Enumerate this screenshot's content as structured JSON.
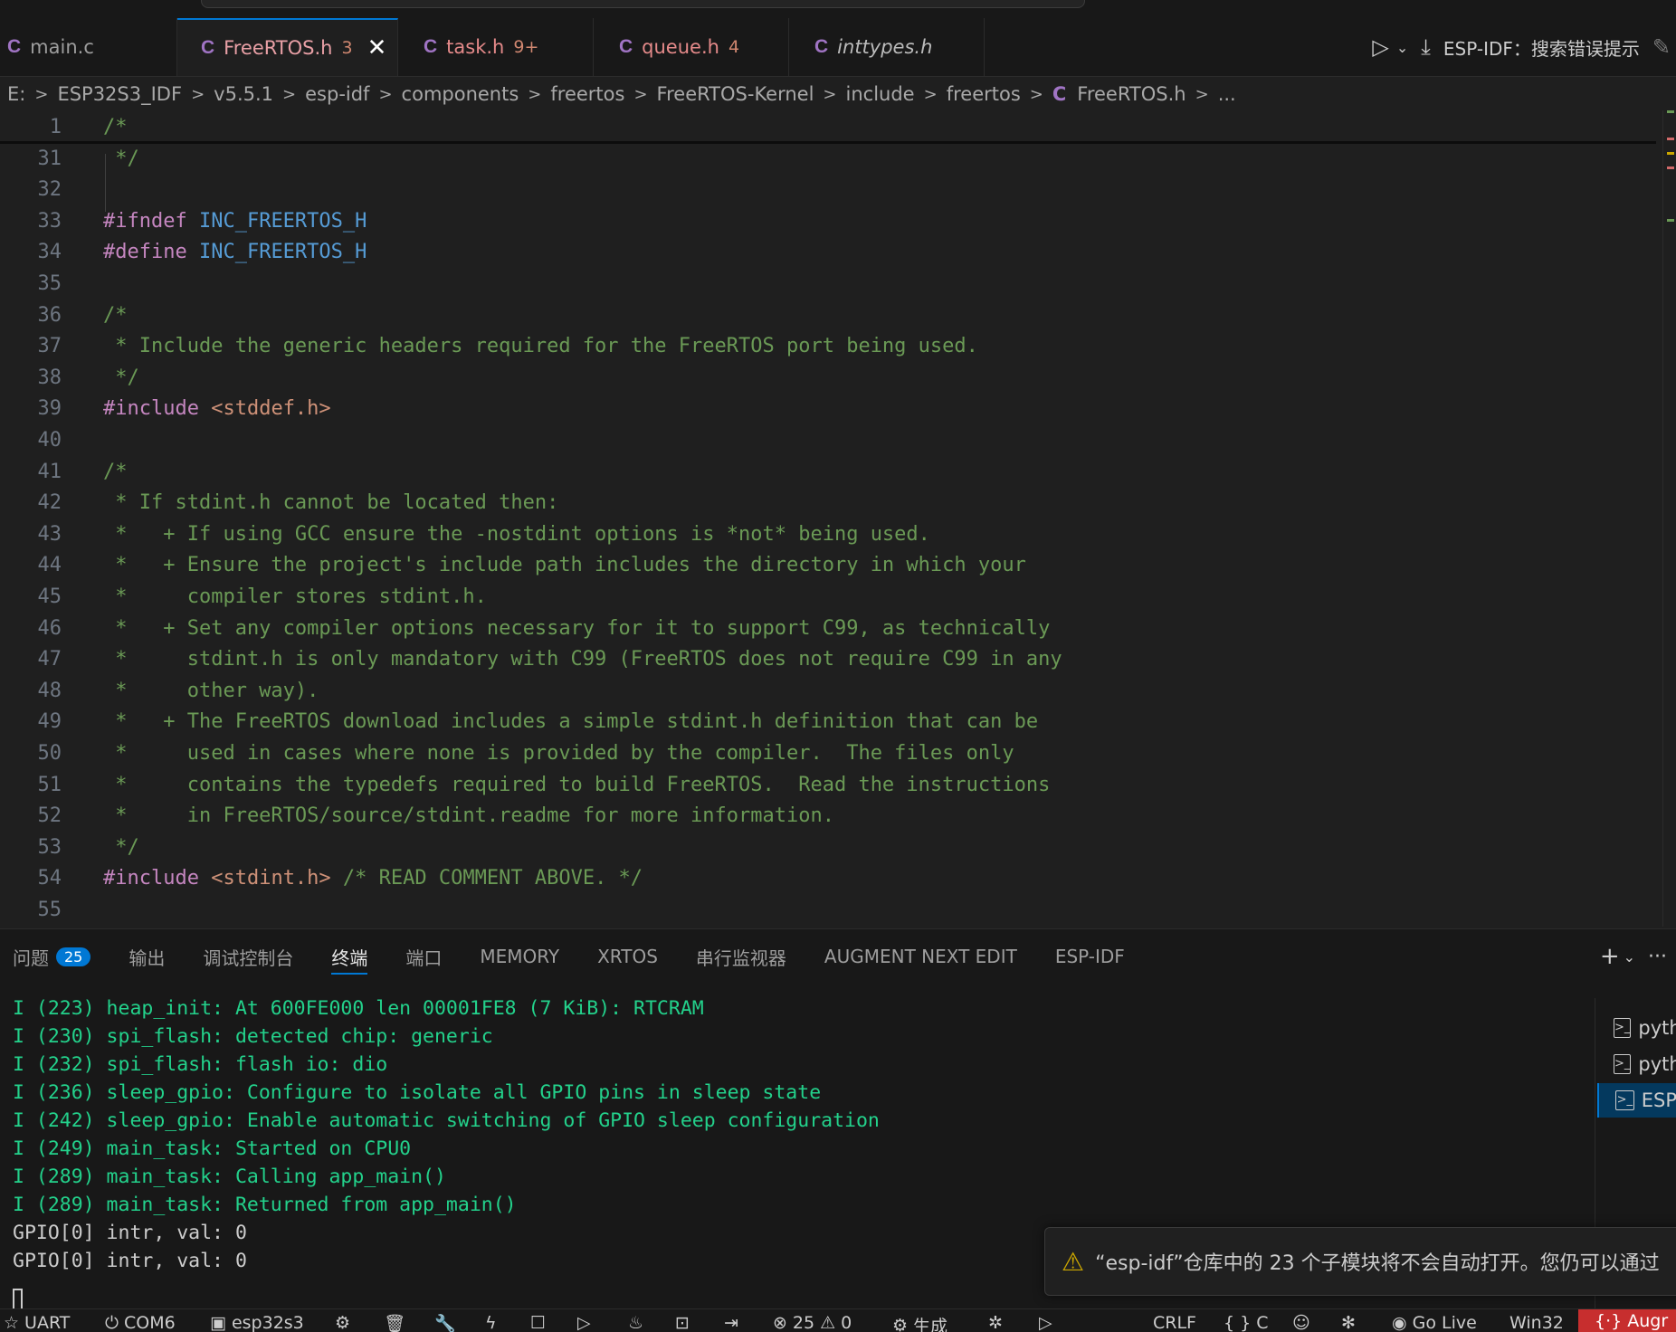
{
  "tabs": [
    {
      "name": "main.c",
      "badge": "",
      "state": "normal"
    },
    {
      "name": "FreeRTOS.h",
      "badge": "3",
      "state": "active"
    },
    {
      "name": "task.h",
      "badge": "9+",
      "state": "mod"
    },
    {
      "name": "queue.h",
      "badge": "4",
      "state": "mod"
    },
    {
      "name": "inttypes.h",
      "badge": "",
      "state": "italic"
    }
  ],
  "tab_icon_letter": "C",
  "tab_actions": {
    "esp_idf_label": "ESP-IDF：搜索错误提示"
  },
  "breadcrumb": [
    "E:",
    "ESP32S3_IDF",
    "v5.5.1",
    "esp-idf",
    "components",
    "freertos",
    "FreeRTOS-Kernel",
    "include",
    "freertos",
    "FreeRTOS.h",
    "..."
  ],
  "editor": {
    "lines": [
      {
        "n": "1",
        "text": "/*"
      },
      {
        "n": "31",
        "text": " */"
      },
      {
        "n": "32",
        "text": ""
      },
      {
        "n": "33",
        "text": "#ifndef INC_FREERTOS_H"
      },
      {
        "n": "34",
        "text": "#define INC_FREERTOS_H"
      },
      {
        "n": "35",
        "text": ""
      },
      {
        "n": "36",
        "text": "/*"
      },
      {
        "n": "37",
        "text": " * Include the generic headers required for the FreeRTOS port being used."
      },
      {
        "n": "38",
        "text": " */"
      },
      {
        "n": "39",
        "text": "#include <stddef.h>"
      },
      {
        "n": "40",
        "text": ""
      },
      {
        "n": "41",
        "text": "/*"
      },
      {
        "n": "42",
        "text": " * If stdint.h cannot be located then:"
      },
      {
        "n": "43",
        "text": " *   + If using GCC ensure the -nostdint options is *not* being used."
      },
      {
        "n": "44",
        "text": " *   + Ensure the project's include path includes the directory in which your"
      },
      {
        "n": "45",
        "text": " *     compiler stores stdint.h."
      },
      {
        "n": "46",
        "text": " *   + Set any compiler options necessary for it to support C99, as technically"
      },
      {
        "n": "47",
        "text": " *     stdint.h is only mandatory with C99 (FreeRTOS does not require C99 in any"
      },
      {
        "n": "48",
        "text": " *     other way)."
      },
      {
        "n": "49",
        "text": " *   + The FreeRTOS download includes a simple stdint.h definition that can be"
      },
      {
        "n": "50",
        "text": " *     used in cases where none is provided by the compiler.  The files only"
      },
      {
        "n": "51",
        "text": " *     contains the typedefs required to build FreeRTOS.  Read the instructions"
      },
      {
        "n": "52",
        "text": " *     in FreeRTOS/source/stdint.readme for more information."
      },
      {
        "n": "53",
        "text": " */"
      },
      {
        "n": "54",
        "text": "#include <stdint.h> /* READ COMMENT ABOVE. */"
      },
      {
        "n": "55",
        "text": ""
      }
    ]
  },
  "panel": {
    "tabs": [
      {
        "label": "问题",
        "count": "25"
      },
      {
        "label": "输出",
        "count": ""
      },
      {
        "label": "调试控制台",
        "count": ""
      },
      {
        "label": "终端",
        "count": ""
      },
      {
        "label": "端口",
        "count": ""
      },
      {
        "label": "MEMORY",
        "count": ""
      },
      {
        "label": "XRTOS",
        "count": ""
      },
      {
        "label": "串行监视器",
        "count": ""
      },
      {
        "label": "AUGMENT NEXT EDIT",
        "count": ""
      },
      {
        "label": "ESP-IDF",
        "count": ""
      }
    ],
    "active_tab": "终端",
    "terminal_lines": [
      {
        "text": "I (223) heap_init: At 600FE000 len 00001FE8 (7 KiB): RTCRAM",
        "kind": "info"
      },
      {
        "text": "I (230) spi_flash: detected chip: generic",
        "kind": "info"
      },
      {
        "text": "I (232) spi_flash: flash io: dio",
        "kind": "info"
      },
      {
        "text": "I (236) sleep_gpio: Configure to isolate all GPIO pins in sleep state",
        "kind": "info"
      },
      {
        "text": "I (242) sleep_gpio: Enable automatic switching of GPIO sleep configuration",
        "kind": "info"
      },
      {
        "text": "I (249) main_task: Started on CPU0",
        "kind": "info"
      },
      {
        "text": "I (289) main_task: Calling app_main()",
        "kind": "info"
      },
      {
        "text": "I (289) main_task: Returned from app_main()",
        "kind": "info"
      },
      {
        "text": "GPIO[0] intr, val: 0",
        "kind": "plain"
      },
      {
        "text": "GPIO[0] intr, val: 0",
        "kind": "plain"
      }
    ],
    "terminal_list": [
      {
        "label": "pyth",
        "active": false
      },
      {
        "label": "pyth",
        "active": false
      },
      {
        "label": "ESP",
        "active": true
      }
    ]
  },
  "notification": {
    "text": "“esp-idf”仓库中的 23 个子模块将不会自动打开。您仍可以通过"
  },
  "statusbar": {
    "uart": "UART",
    "port": "COM6",
    "target": "esp32s3",
    "errors": "25",
    "warnings": "0",
    "build": "生成",
    "eol": "CRLF",
    "lang": "C",
    "golive": "Go Live",
    "platform": "Win32",
    "remote": "Augr"
  },
  "colors": {
    "accent": "#0078d4",
    "comment": "#6a9955",
    "directive": "#c586c0",
    "macro": "#569cd6",
    "string": "#ce9178",
    "terminal_info": "#23d18b",
    "remote": "#c72e2e",
    "warning": "#cca700"
  }
}
